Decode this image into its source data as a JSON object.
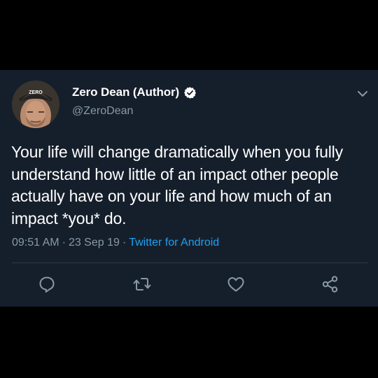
{
  "tweet": {
    "author": {
      "display_name": "Zero Dean (Author)",
      "handle": "@ZeroDean",
      "verified": true,
      "avatar_cap_text": "ZERO"
    },
    "text": "Your life will change dramatically when you fully understand how little of an impact other people actually have on your life and how much of an impact *you* do.",
    "time": "09:51 AM",
    "date": "23 Sep 19",
    "separator": "·",
    "source": "Twitter for Android"
  },
  "icons": {
    "reply": "reply-icon",
    "retweet": "retweet-icon",
    "like": "heart-icon",
    "share": "share-icon",
    "menu": "chevron-down-icon",
    "verified": "verified-badge-icon"
  },
  "colors": {
    "background": "#000000",
    "card": "#151f2b",
    "text": "#ffffff",
    "secondary": "#8899a6",
    "link": "#1da1f2",
    "divider": "#2c3a48"
  }
}
